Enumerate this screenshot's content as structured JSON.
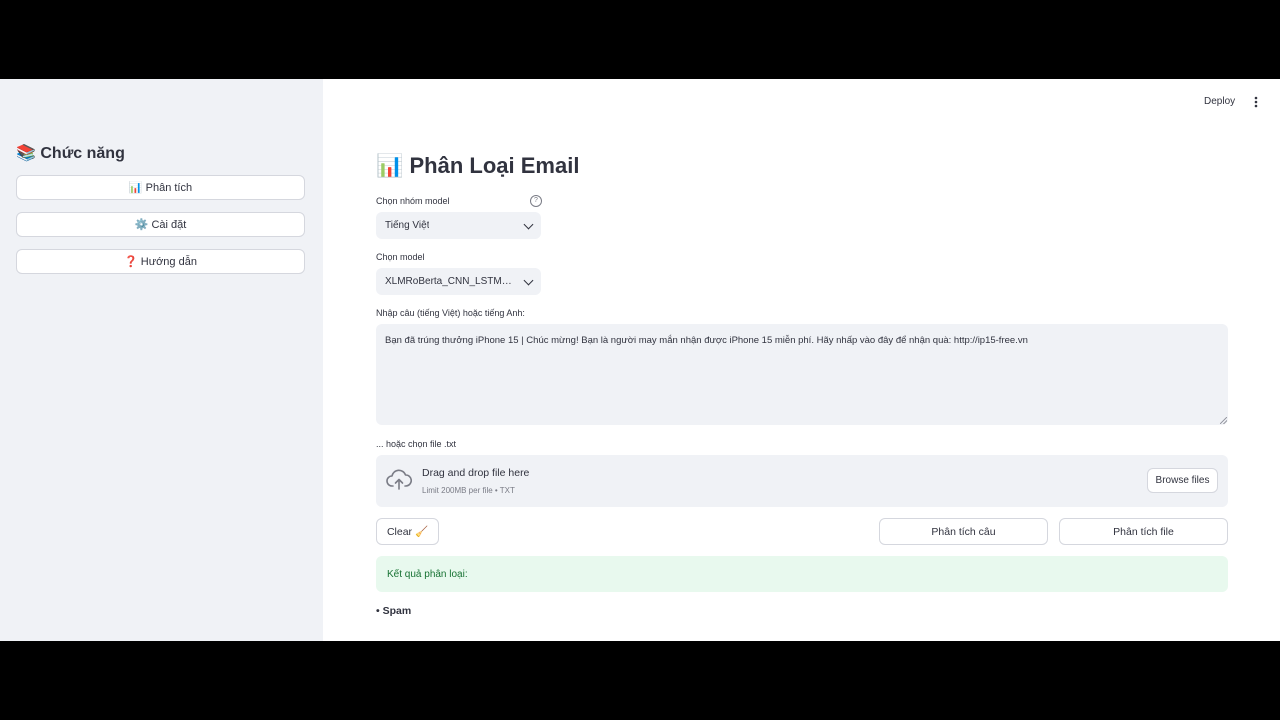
{
  "header": {
    "deploy_label": "Deploy"
  },
  "sidebar": {
    "title": "📚 Chức năng",
    "items": [
      {
        "label": "📊 Phân tích"
      },
      {
        "label": "⚙️ Cài đặt"
      },
      {
        "label": "❓ Hướng dẫn"
      }
    ]
  },
  "main": {
    "title": "📊 Phân Loại Email",
    "model_group": {
      "label": "Chọn nhóm model",
      "value": "Tiếng Việt",
      "help": "?"
    },
    "model": {
      "label": "Chọn model",
      "value": "XLMRoBerta_CNN_LSTM_..."
    },
    "input": {
      "label": "Nhập câu (tiếng Việt) hoặc tiếng Anh:",
      "value": "Bạn đã trúng thưởng iPhone 15 | Chúc mừng! Bạn là người may mắn nhận được iPhone 15 miễn phí. Hãy nhấp vào đây để nhận quà: http://ip15-free.vn"
    },
    "file": {
      "label": "... hoặc chọn file .txt",
      "drop_text": "Drag and drop file here",
      "limit_text": "Limit 200MB per file • TXT",
      "browse_label": "Browse files"
    },
    "buttons": {
      "clear": "Clear 🧹",
      "analyze_sentence": "Phân tích câu",
      "analyze_file": "Phân tích file"
    },
    "result": {
      "label": "Kết quả phân loại:",
      "item": "• Spam"
    }
  }
}
